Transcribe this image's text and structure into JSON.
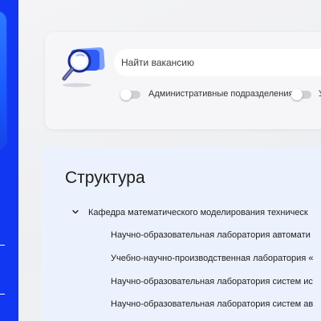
{
  "colors": {
    "sidebar": "#1237f2",
    "structure_background": "#ecf2fd",
    "search_card_background": "#f6f6f8"
  },
  "search": {
    "placeholder": "Найти вакансию",
    "icon": "magnifier-icon",
    "filters": [
      {
        "label": "Административные подразделения",
        "checked": false
      },
      {
        "label": "У",
        "checked": false
      }
    ]
  },
  "structure": {
    "title": "Структура",
    "department": {
      "label": "Кафедра математического моделирования техническ",
      "expanded": true,
      "icon": "chevron-down-icon"
    },
    "labs": [
      "Научно-образовательная лаборатория автомати",
      "Учебно-научно-производственная лаборатория «",
      "Научно-образовательная лаборатория систем ис",
      "Научно-образовательная лаборатория систем ав"
    ]
  }
}
